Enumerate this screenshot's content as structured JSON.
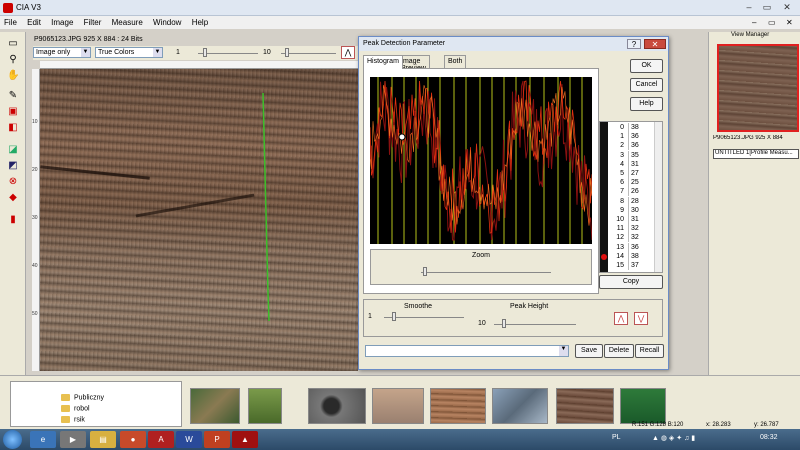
{
  "app": {
    "title": "CIA V3"
  },
  "menu": [
    "File",
    "Edit",
    "Image",
    "Filter",
    "Measure",
    "Window",
    "Help"
  ],
  "document": {
    "tab_label": "P9065123.JPG   925 X 884 : 24 Bits",
    "view_mode": "Image only",
    "color_mode": "True Colors",
    "slider_min": "1",
    "slider_max": "10"
  },
  "ruler_v": [
    "10",
    "20",
    "30",
    "40",
    "50"
  ],
  "dialog": {
    "title": "Peak Detection Parameter",
    "tabs": [
      "Histogram",
      "Image Preview",
      "Both"
    ],
    "active_tab": "Histogram",
    "ok_label": "OK",
    "cancel_label": "Cancel",
    "help_label": "Help",
    "copy_label": "Copy",
    "zoom_label": "Zoom",
    "smoothe_label": "Smoothe",
    "smoothe_value": "1",
    "peak_height_label": "Peak Height",
    "peak_height_value": "10",
    "save_label": "Save",
    "delete_label": "Delete",
    "recall_label": "Recall",
    "preset_value": "",
    "peaks": [
      {
        "i": "0",
        "v": "38"
      },
      {
        "i": "1",
        "v": "36"
      },
      {
        "i": "2",
        "v": "36"
      },
      {
        "i": "3",
        "v": "35"
      },
      {
        "i": "4",
        "v": "31"
      },
      {
        "i": "5",
        "v": "27"
      },
      {
        "i": "6",
        "v": "25"
      },
      {
        "i": "7",
        "v": "26"
      },
      {
        "i": "8",
        "v": "28"
      },
      {
        "i": "9",
        "v": "30"
      },
      {
        "i": "10",
        "v": "31"
      },
      {
        "i": "11",
        "v": "32"
      },
      {
        "i": "12",
        "v": "32"
      },
      {
        "i": "13",
        "v": "36"
      },
      {
        "i": "14",
        "v": "38"
      },
      {
        "i": "15",
        "v": "37"
      }
    ]
  },
  "view_manager": {
    "title": "View Manager",
    "items": [
      "P9065123.JPG   925 X 884",
      "UNTITLED 1[Profile Measu..."
    ]
  },
  "folders": [
    "Publiczny",
    "robol",
    "rsik"
  ],
  "status": {
    "rgb": "R:151 G:128 B:120",
    "x": "x: 28.283",
    "y": "y: 26.787"
  },
  "taskbar": {
    "lang": "PL",
    "time": "08:32"
  },
  "colors": {
    "accent_red": "#e01010",
    "histogram_peak_line": "#b5c21a",
    "profile_line": "#3bbf2a"
  }
}
